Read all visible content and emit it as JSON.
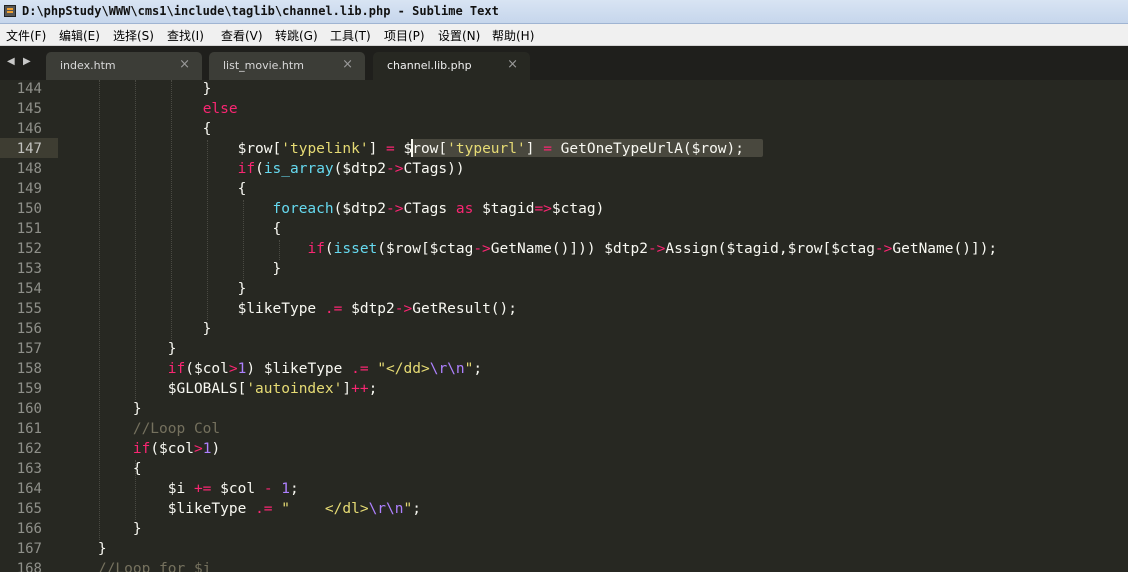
{
  "window": {
    "title": "D:\\phpStudy\\WWW\\cms1\\include\\taglib\\channel.lib.php - Sublime Text",
    "app_icon": "sublime-text-icon"
  },
  "menu": [
    "文件(F)",
    "编辑(E)",
    "选择(S)",
    "查找(I)",
    "查看(V)",
    "转跳(G)",
    "工具(T)",
    "项目(P)",
    "设置(N)",
    "帮助(H)"
  ],
  "nav": {
    "back_icon": "arrow-left-icon",
    "forward_icon": "arrow-right-icon",
    "back": "◀",
    "forward": "▶"
  },
  "tabs": [
    {
      "label": "index.htm",
      "close": "×",
      "active": false
    },
    {
      "label": "list_movie.htm",
      "close": "×",
      "active": false
    },
    {
      "label": "channel.lib.php",
      "close": "×",
      "active": true
    }
  ],
  "editor": {
    "current_line": 147,
    "line_numbers": [
      144,
      145,
      146,
      147,
      148,
      149,
      150,
      151,
      152,
      153,
      154,
      155,
      156,
      157,
      158,
      159,
      160,
      161,
      162,
      163,
      164,
      165,
      166,
      167,
      168
    ],
    "lines": [
      [
        {
          "t": "                }",
          "c": "p"
        }
      ],
      [
        {
          "t": "                ",
          "c": "p"
        },
        {
          "t": "else",
          "c": "k"
        }
      ],
      [
        {
          "t": "                {",
          "c": "p"
        }
      ],
      [
        {
          "t": "                    $row[",
          "c": "p"
        },
        {
          "t": "'typelink'",
          "c": "s"
        },
        {
          "t": "] ",
          "c": "p"
        },
        {
          "t": "=",
          "c": "k"
        },
        {
          "t": " $row[",
          "c": "p"
        },
        {
          "t": "'typeurl'",
          "c": "s"
        },
        {
          "t": "] ",
          "c": "p"
        },
        {
          "t": "=",
          "c": "k"
        },
        {
          "t": " GetOneTypeUrlA($row);",
          "c": "p"
        }
      ],
      [
        {
          "t": "                    ",
          "c": "p"
        },
        {
          "t": "if",
          "c": "k"
        },
        {
          "t": "(",
          "c": "p"
        },
        {
          "t": "is_array",
          "c": "f"
        },
        {
          "t": "($dtp2",
          "c": "p"
        },
        {
          "t": "->",
          "c": "k"
        },
        {
          "t": "CTags))",
          "c": "p"
        }
      ],
      [
        {
          "t": "                    {",
          "c": "p"
        }
      ],
      [
        {
          "t": "                        ",
          "c": "p"
        },
        {
          "t": "foreach",
          "c": "f"
        },
        {
          "t": "($dtp2",
          "c": "p"
        },
        {
          "t": "->",
          "c": "k"
        },
        {
          "t": "CTags ",
          "c": "p"
        },
        {
          "t": "as",
          "c": "k"
        },
        {
          "t": " $tagid",
          "c": "p"
        },
        {
          "t": "=>",
          "c": "k"
        },
        {
          "t": "$ctag)",
          "c": "p"
        }
      ],
      [
        {
          "t": "                        {",
          "c": "p"
        }
      ],
      [
        {
          "t": "                            ",
          "c": "p"
        },
        {
          "t": "if",
          "c": "k"
        },
        {
          "t": "(",
          "c": "p"
        },
        {
          "t": "isset",
          "c": "f"
        },
        {
          "t": "($row[$ctag",
          "c": "p"
        },
        {
          "t": "->",
          "c": "k"
        },
        {
          "t": "GetName()])) $dtp2",
          "c": "p"
        },
        {
          "t": "->",
          "c": "k"
        },
        {
          "t": "Assign($tagid,$row[$ctag",
          "c": "p"
        },
        {
          "t": "->",
          "c": "k"
        },
        {
          "t": "GetName()]);",
          "c": "p"
        }
      ],
      [
        {
          "t": "                        }",
          "c": "p"
        }
      ],
      [
        {
          "t": "                    }",
          "c": "p"
        }
      ],
      [
        {
          "t": "                    $likeType ",
          "c": "p"
        },
        {
          "t": ".=",
          "c": "k"
        },
        {
          "t": " $dtp2",
          "c": "p"
        },
        {
          "t": "->",
          "c": "k"
        },
        {
          "t": "GetResult();",
          "c": "p"
        }
      ],
      [
        {
          "t": "                }",
          "c": "p"
        }
      ],
      [
        {
          "t": "            }",
          "c": "p"
        }
      ],
      [
        {
          "t": "            ",
          "c": "p"
        },
        {
          "t": "if",
          "c": "k"
        },
        {
          "t": "($col",
          "c": "p"
        },
        {
          "t": ">",
          "c": "k"
        },
        {
          "t": "1",
          "c": "n"
        },
        {
          "t": ") $likeType ",
          "c": "p"
        },
        {
          "t": ".=",
          "c": "k"
        },
        {
          "t": " ",
          "c": "p"
        },
        {
          "t": "\"</dd>",
          "c": "s"
        },
        {
          "t": "\\r\\n",
          "c": "n"
        },
        {
          "t": "\"",
          "c": "s"
        },
        {
          "t": ";",
          "c": "p"
        }
      ],
      [
        {
          "t": "            $GLOBALS[",
          "c": "p"
        },
        {
          "t": "'autoindex'",
          "c": "s"
        },
        {
          "t": "]",
          "c": "p"
        },
        {
          "t": "++",
          "c": "k"
        },
        {
          "t": ";",
          "c": "p"
        }
      ],
      [
        {
          "t": "        }",
          "c": "p"
        }
      ],
      [
        {
          "t": "        ",
          "c": "p"
        },
        {
          "t": "//Loop Col",
          "c": "c"
        }
      ],
      [
        {
          "t": "        ",
          "c": "p"
        },
        {
          "t": "if",
          "c": "k"
        },
        {
          "t": "($col",
          "c": "p"
        },
        {
          "t": ">",
          "c": "k"
        },
        {
          "t": "1",
          "c": "n"
        },
        {
          "t": ")",
          "c": "p"
        }
      ],
      [
        {
          "t": "        {",
          "c": "p"
        }
      ],
      [
        {
          "t": "            $i ",
          "c": "p"
        },
        {
          "t": "+=",
          "c": "k"
        },
        {
          "t": " $col ",
          "c": "p"
        },
        {
          "t": "-",
          "c": "k"
        },
        {
          "t": " ",
          "c": "p"
        },
        {
          "t": "1",
          "c": "n"
        },
        {
          "t": ";",
          "c": "p"
        }
      ],
      [
        {
          "t": "            $likeType ",
          "c": "p"
        },
        {
          "t": ".=",
          "c": "k"
        },
        {
          "t": " ",
          "c": "p"
        },
        {
          "t": "\"    </dl>",
          "c": "s"
        },
        {
          "t": "\\r\\n",
          "c": "n"
        },
        {
          "t": "\"",
          "c": "s"
        },
        {
          "t": ";",
          "c": "p"
        }
      ],
      [
        {
          "t": "        }",
          "c": "p"
        }
      ],
      [
        {
          "t": "    }",
          "c": "p"
        }
      ],
      [
        {
          "t": "    ",
          "c": "p"
        },
        {
          "t": "//Loop for $i",
          "c": "c"
        }
      ]
    ]
  }
}
